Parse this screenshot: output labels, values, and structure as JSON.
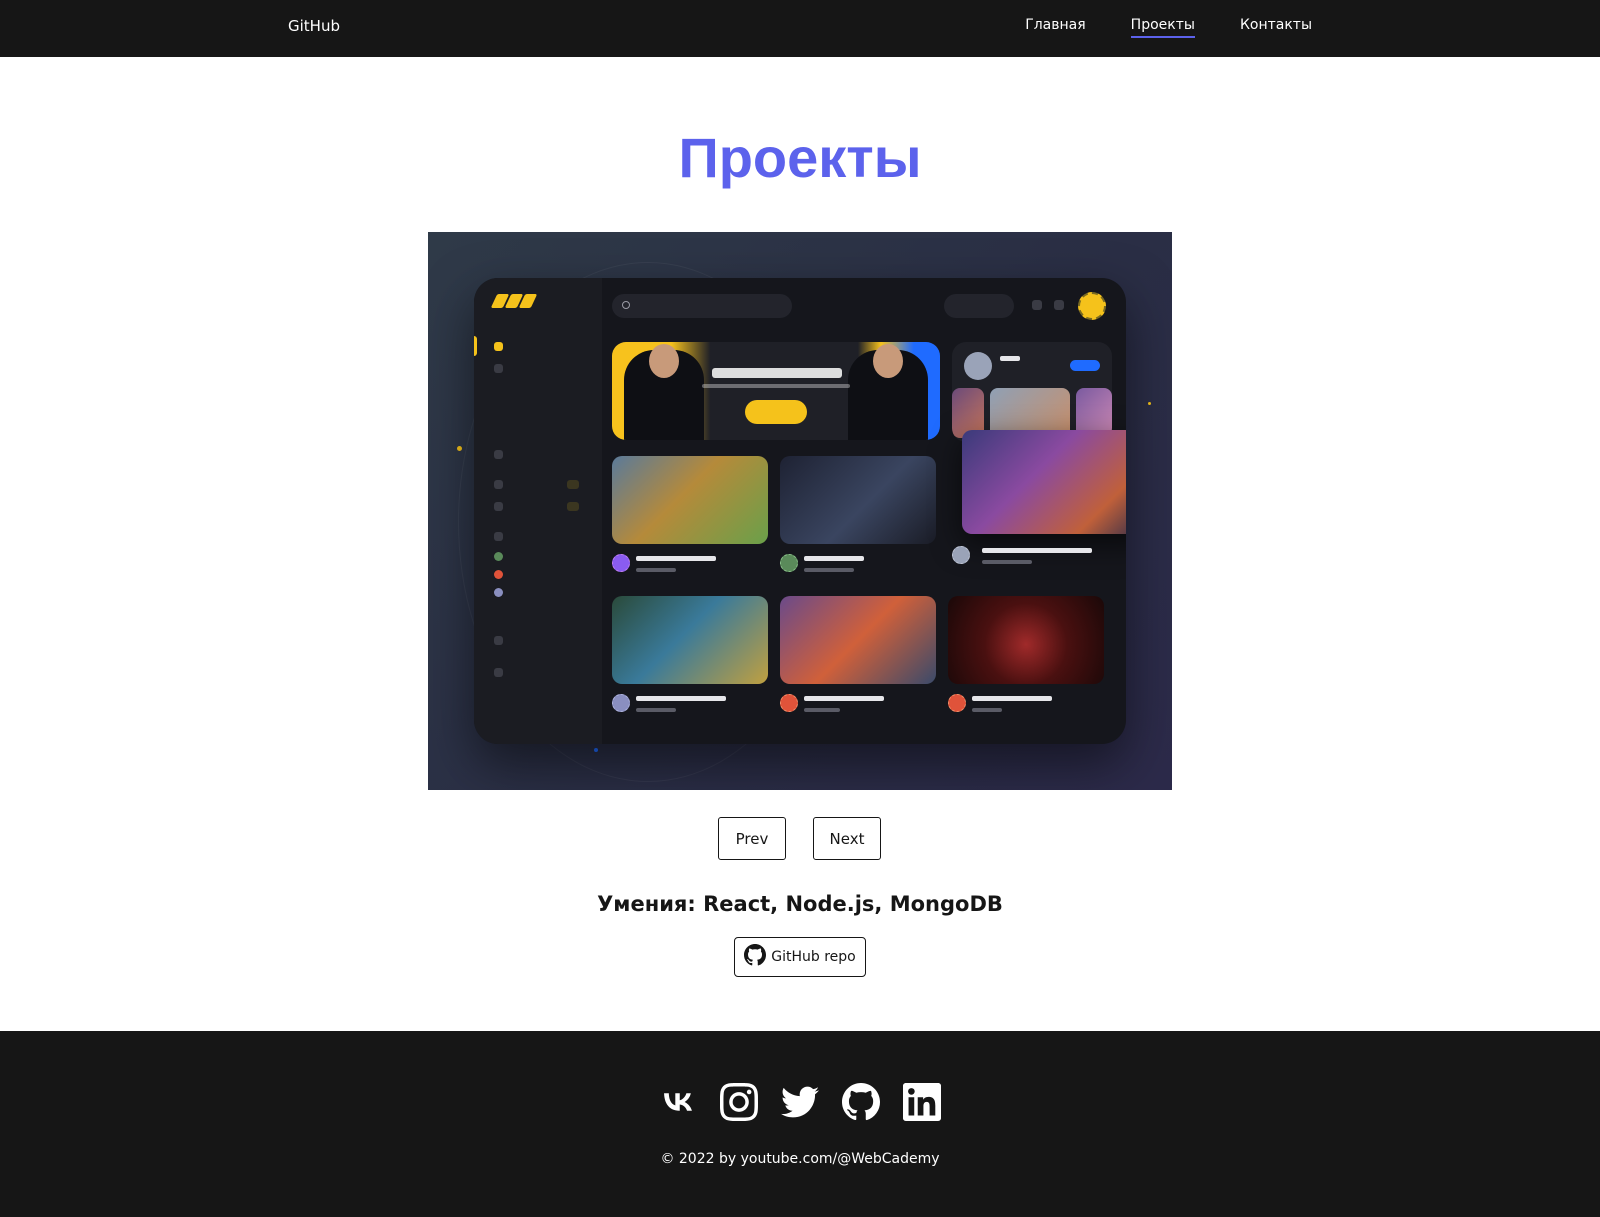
{
  "header": {
    "logo": "GitHub",
    "nav": [
      {
        "label": "Главная",
        "active": false
      },
      {
        "label": "Проекты",
        "active": true
      },
      {
        "label": "Контакты",
        "active": false
      }
    ]
  },
  "page": {
    "title": "Проекты"
  },
  "project": {
    "preview_icon": "project-preview-image",
    "prev_label": "Prev",
    "next_label": "Next",
    "skills": "Умения: React, Node.js, MongoDB",
    "repo_label": "GitHub repo",
    "repo_icon": "github-icon"
  },
  "footer": {
    "socials": [
      {
        "name": "vk-icon"
      },
      {
        "name": "instagram-icon"
      },
      {
        "name": "twitter-icon"
      },
      {
        "name": "github-icon"
      },
      {
        "name": "linkedin-icon"
      }
    ],
    "copyright": "© 2022 by youtube.com/@WebCademy"
  },
  "colors": {
    "accent": "#5c62ec",
    "dark": "#161616",
    "background": "#ffffff"
  }
}
